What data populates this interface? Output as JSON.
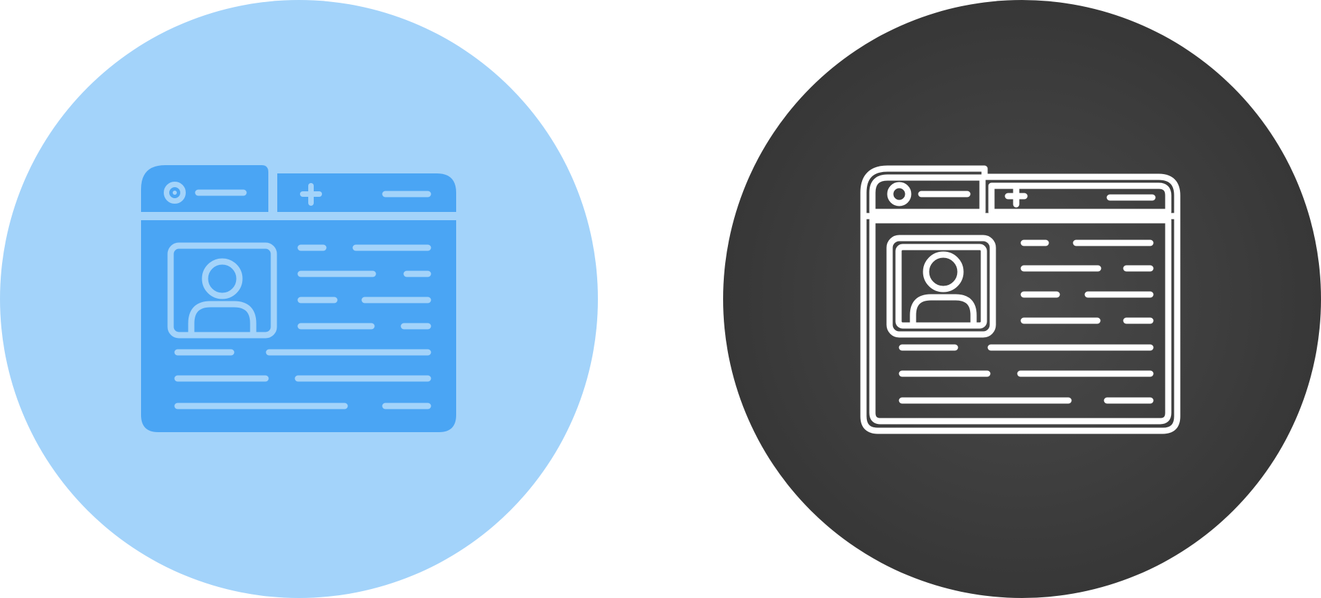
{
  "icons": [
    {
      "name": "profile-webpage-icon",
      "style": "glyph",
      "circle_color": "#a3d3fa",
      "fill_color": "#4aa5f4",
      "stroke_color": "#a3d3fa"
    },
    {
      "name": "profile-webpage-icon",
      "style": "line",
      "circle_color_center": "#4a4a4a",
      "circle_color_edge": "#2f2f2f",
      "stroke_color": "#ffffff"
    }
  ]
}
